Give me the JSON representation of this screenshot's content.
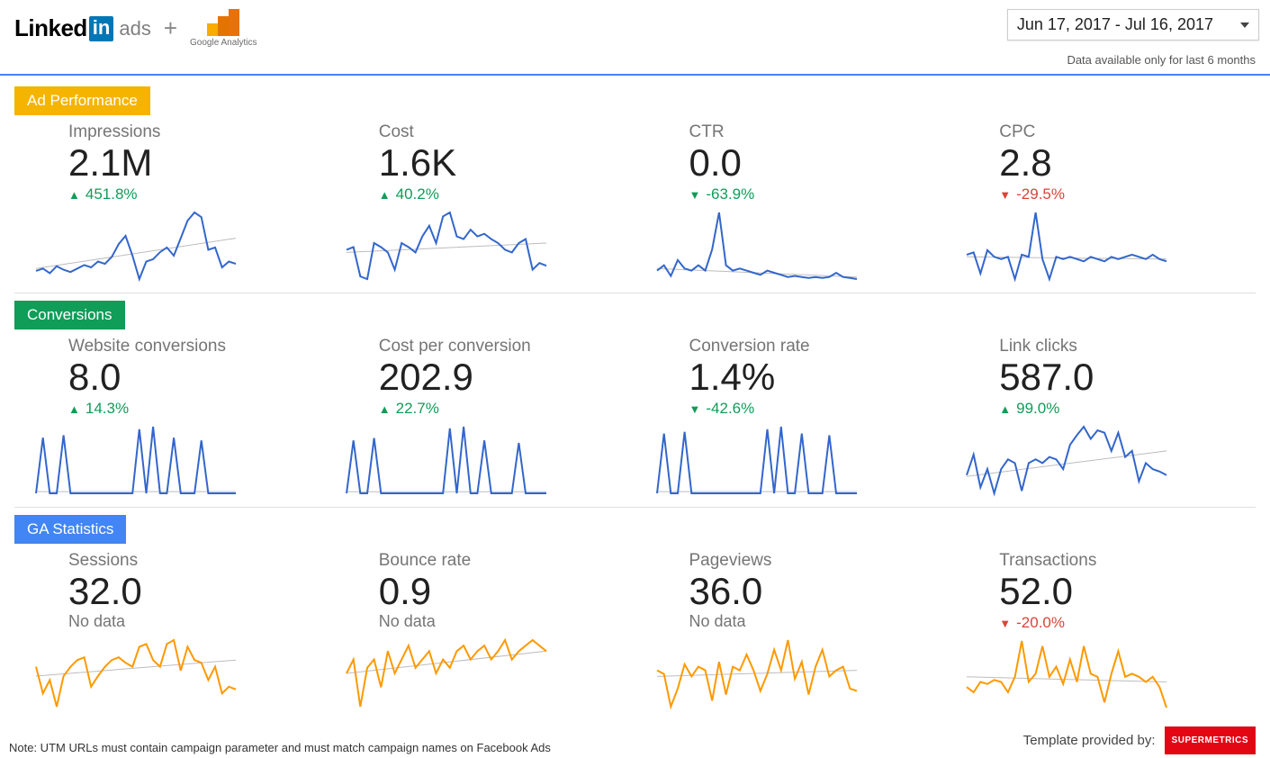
{
  "header": {
    "linkedin_text": "Linked",
    "linkedin_in": "in",
    "linkedin_ads": "ads",
    "plus": "+",
    "ga_label": "Google Analytics",
    "date_range": "Jun 17, 2017 - Jul 16, 2017",
    "availability_note": "Data available only for last 6 months"
  },
  "sections": {
    "ad_perf": "Ad Performance",
    "conv": "Conversions",
    "ga": "GA Statistics"
  },
  "metrics": {
    "impressions": {
      "label": "Impressions",
      "value": "2.1M",
      "delta": "451.8%",
      "dir": "up"
    },
    "cost": {
      "label": "Cost",
      "value": "1.6K",
      "delta": "40.2%",
      "dir": "up"
    },
    "ctr": {
      "label": "CTR",
      "value": "0.0",
      "delta": "-63.9%",
      "dir": "down_green"
    },
    "cpc": {
      "label": "CPC",
      "value": "2.8",
      "delta": "-29.5%",
      "dir": "down_red"
    },
    "webconv": {
      "label": "Website conversions",
      "value": "8.0",
      "delta": "14.3%",
      "dir": "up"
    },
    "cpcv": {
      "label": "Cost per conversion",
      "value": "202.9",
      "delta": "22.7%",
      "dir": "up"
    },
    "convrate": {
      "label": "Conversion rate",
      "value": "1.4%",
      "delta": "-42.6%",
      "dir": "down_green"
    },
    "linkclicks": {
      "label": "Link clicks",
      "value": "587.0",
      "delta": "99.0%",
      "dir": "up"
    },
    "sessions": {
      "label": "Sessions",
      "value": "32.0",
      "nodata": "No data"
    },
    "bounce": {
      "label": "Bounce rate",
      "value": "0.9",
      "nodata": "No data"
    },
    "pageviews": {
      "label": "Pageviews",
      "value": "36.0",
      "nodata": "No data"
    },
    "trans": {
      "label": "Transactions",
      "value": "52.0",
      "delta": "-20.0%",
      "dir": "down_red"
    }
  },
  "footer": {
    "note": "Note: UTM URLs must contain campaign parameter and must match campaign names on Facebook Ads",
    "provided": "Template provided by:",
    "brand": "SUPERMETRICS"
  },
  "chart_data": [
    {
      "name": "Impressions",
      "type": "line",
      "color": "#3366CC",
      "values": [
        42,
        44,
        40,
        46,
        43,
        41,
        44,
        47,
        45,
        50,
        48,
        54,
        65,
        72,
        55,
        35,
        50,
        52,
        58,
        62,
        55,
        70,
        85,
        92,
        88,
        60,
        62,
        45,
        50,
        48
      ],
      "trend_start": 44,
      "trend_end": 70
    },
    {
      "name": "Cost",
      "type": "line",
      "color": "#3366CC",
      "values": [
        50,
        52,
        30,
        28,
        55,
        52,
        48,
        35,
        55,
        52,
        48,
        60,
        68,
        55,
        75,
        78,
        60,
        58,
        65,
        60,
        62,
        58,
        55,
        50,
        48,
        55,
        58,
        35,
        40,
        38
      ],
      "trend_start": 48,
      "trend_end": 55
    },
    {
      "name": "CTR",
      "type": "line",
      "color": "#3366CC",
      "values": [
        40,
        45,
        35,
        50,
        42,
        40,
        45,
        40,
        60,
        95,
        45,
        40,
        42,
        40,
        38,
        36,
        40,
        38,
        36,
        34,
        35,
        34,
        33,
        34,
        33,
        34,
        38,
        34,
        33,
        32
      ],
      "trend_start": 42,
      "trend_end": 34
    },
    {
      "name": "CPC",
      "type": "line",
      "color": "#3366CC",
      "values": [
        52,
        54,
        35,
        56,
        50,
        48,
        50,
        30,
        52,
        50,
        90,
        48,
        30,
        50,
        48,
        50,
        48,
        46,
        50,
        48,
        46,
        50,
        48,
        50,
        52,
        50,
        48,
        52,
        48,
        46
      ],
      "trend_start": 50,
      "trend_end": 48
    },
    {
      "name": "Website conversions",
      "type": "line",
      "color": "#3366CC",
      "values": [
        10,
        75,
        10,
        10,
        78,
        10,
        10,
        10,
        10,
        10,
        10,
        10,
        10,
        10,
        10,
        85,
        10,
        88,
        10,
        10,
        75,
        10,
        10,
        10,
        72,
        10,
        10,
        10,
        10,
        10
      ],
      "trend_start": 12,
      "trend_end": 12
    },
    {
      "name": "Cost per conversion",
      "type": "line",
      "color": "#3366CC",
      "values": [
        10,
        75,
        10,
        10,
        78,
        10,
        10,
        10,
        10,
        10,
        10,
        10,
        10,
        10,
        10,
        90,
        10,
        92,
        10,
        10,
        75,
        10,
        10,
        10,
        10,
        72,
        10,
        10,
        10,
        10
      ],
      "trend_start": 12,
      "trend_end": 12
    },
    {
      "name": "Conversion rate",
      "type": "line",
      "color": "#3366CC",
      "values": [
        10,
        80,
        10,
        10,
        82,
        10,
        10,
        10,
        10,
        10,
        10,
        10,
        10,
        10,
        10,
        10,
        85,
        10,
        88,
        10,
        10,
        80,
        10,
        10,
        10,
        78,
        10,
        10,
        10,
        10
      ],
      "trend_start": 12,
      "trend_end": 12
    },
    {
      "name": "Link clicks",
      "type": "line",
      "color": "#3366CC",
      "values": [
        45,
        62,
        35,
        50,
        30,
        50,
        58,
        55,
        32,
        55,
        58,
        55,
        60,
        58,
        50,
        70,
        78,
        85,
        75,
        82,
        80,
        65,
        80,
        60,
        65,
        40,
        55,
        50,
        48,
        45
      ],
      "trend_start": 44,
      "trend_end": 65
    },
    {
      "name": "Sessions",
      "type": "line",
      "color": "#FF9900",
      "values": [
        55,
        35,
        45,
        25,
        48,
        55,
        60,
        62,
        40,
        48,
        55,
        60,
        62,
        58,
        55,
        70,
        72,
        60,
        55,
        72,
        75,
        52,
        70,
        60,
        58,
        45,
        55,
        35,
        40,
        38
      ],
      "trend_start": 48,
      "trend_end": 60
    },
    {
      "name": "Bounce rate",
      "type": "line",
      "color": "#FF9900",
      "values": [
        50,
        55,
        38,
        52,
        55,
        45,
        58,
        50,
        55,
        60,
        52,
        55,
        58,
        50,
        55,
        52,
        58,
        60,
        55,
        58,
        60,
        55,
        58,
        62,
        55,
        58,
        60,
        62,
        60,
        58
      ],
      "trend_start": 50,
      "trend_end": 58
    },
    {
      "name": "Pageviews",
      "type": "line",
      "color": "#FF9900",
      "values": [
        55,
        52,
        25,
        40,
        60,
        50,
        58,
        55,
        30,
        62,
        35,
        58,
        55,
        68,
        55,
        38,
        52,
        72,
        55,
        80,
        48,
        62,
        35,
        58,
        72,
        50,
        55,
        58,
        40,
        38
      ],
      "trend_start": 50,
      "trend_end": 55
    },
    {
      "name": "Transactions",
      "type": "line",
      "color": "#FF9900",
      "values": [
        45,
        40,
        50,
        48,
        52,
        50,
        40,
        55,
        90,
        50,
        58,
        85,
        55,
        65,
        48,
        72,
        50,
        85,
        58,
        55,
        30,
        58,
        80,
        55,
        58,
        55,
        50,
        55,
        45,
        25
      ],
      "trend_start": 55,
      "trend_end": 50
    }
  ]
}
